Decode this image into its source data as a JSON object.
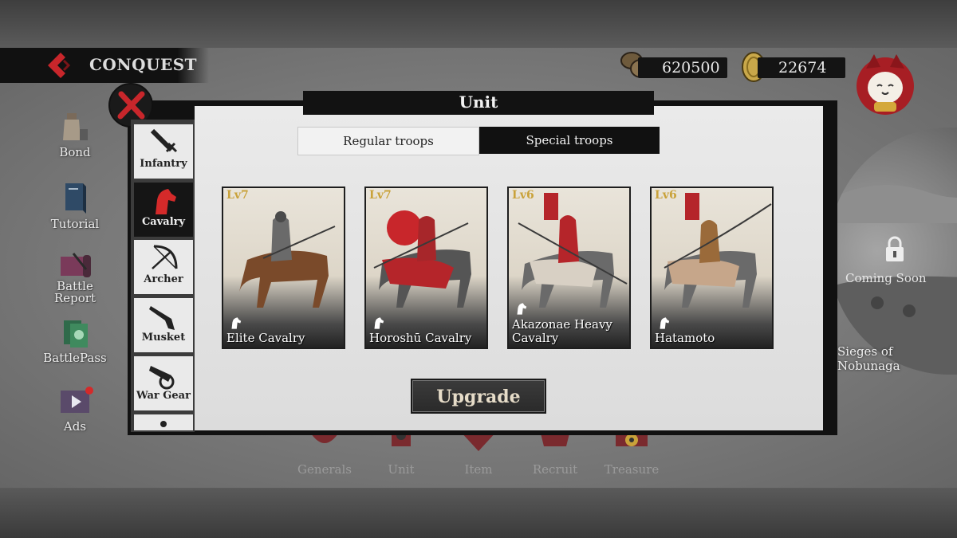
{
  "header": {
    "title": "CONQUEST",
    "coins": "620500",
    "gold": "22674"
  },
  "left_menu": [
    {
      "label": "Bond",
      "icon": "sake-bottle-icon"
    },
    {
      "label": "Tutorial",
      "icon": "book-icon"
    },
    {
      "label": "Battle Report",
      "icon": "scroll-icon"
    },
    {
      "label": "BattlePass",
      "icon": "pass-icon"
    },
    {
      "label": "Ads",
      "icon": "film-icon"
    }
  ],
  "right_panel": {
    "coming_soon": "Coming Soon",
    "event": "Sieges of Nobunaga"
  },
  "bottom_nav": [
    "Generals",
    "Unit",
    "Item",
    "Recruit",
    "Treasure"
  ],
  "modal": {
    "title": "Unit",
    "categories": [
      "Infantry",
      "Cavalry",
      "Archer",
      "Musket",
      "War Gear"
    ],
    "active_category": "Cavalry",
    "tabs": [
      "Regular troops",
      "Special troops"
    ],
    "active_tab": "Special troops",
    "units": [
      {
        "level": "Lv7",
        "name": "Elite Cavalry"
      },
      {
        "level": "Lv7",
        "name": "Horoshū Cavalry"
      },
      {
        "level": "Lv6",
        "name": "Akazonae Heavy Cavalry"
      },
      {
        "level": "Lv6",
        "name": "Hatamoto"
      }
    ],
    "upgrade_label": "Upgrade"
  },
  "colors": {
    "accent_red": "#b3232a",
    "gold_text": "#c9a23a",
    "panel_dark": "#121212"
  }
}
